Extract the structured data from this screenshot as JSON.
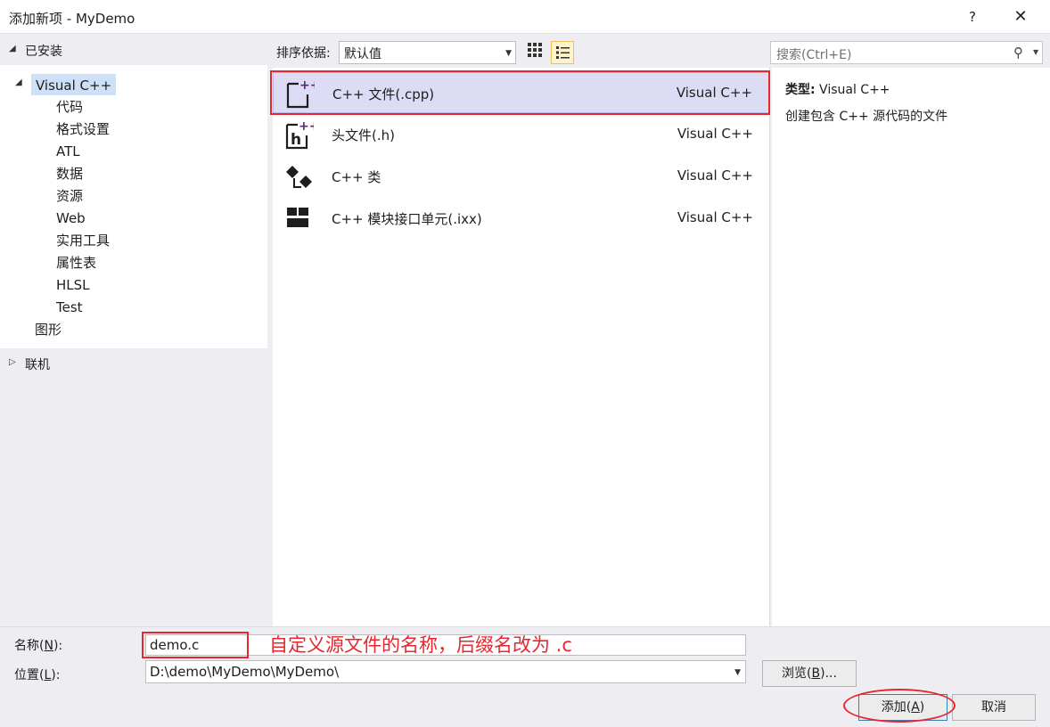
{
  "window": {
    "title": "添加新项 - MyDemo",
    "help": "?",
    "close": "✕"
  },
  "installed": {
    "label": "已安装"
  },
  "tree": {
    "root": "Visual C++",
    "children": [
      "代码",
      "格式设置",
      "ATL",
      "数据",
      "资源",
      "Web",
      "实用工具",
      "属性表",
      "HLSL",
      "Test"
    ],
    "sibling": "图形"
  },
  "online": {
    "label": "联机"
  },
  "toolbar": {
    "sort_label": "排序依据:",
    "sort_value": "默认值"
  },
  "templates": [
    {
      "name": "C++ 文件(.cpp)",
      "lang": "Visual C++",
      "icon": "cpp-file-icon"
    },
    {
      "name": "头文件(.h)",
      "lang": "Visual C++",
      "icon": "header-file-icon"
    },
    {
      "name": "C++ 类",
      "lang": "Visual C++",
      "icon": "class-icon"
    },
    {
      "name": "C++ 模块接口单元(.ixx)",
      "lang": "Visual C++",
      "icon": "module-icon"
    }
  ],
  "search": {
    "placeholder": "搜索(Ctrl+E)"
  },
  "details": {
    "type_label": "类型:",
    "type_value": " Visual C++",
    "description": "创建包含 C++ 源代码的文件"
  },
  "form": {
    "name_label_pre": "名称(",
    "name_label_key": "N",
    "name_label_post": "):",
    "name_value": "demo.c",
    "location_label_pre": "位置(",
    "location_label_key": "L",
    "location_label_post": "):",
    "location_value": "D:\\demo\\MyDemo\\MyDemo\\"
  },
  "annotation": "自定义源文件的名称，后缀名改为 .c",
  "buttons": {
    "browse_pre": "浏览(",
    "browse_key": "B",
    "browse_post": ")...",
    "add_pre": "添加(",
    "add_key": "A",
    "add_post": ")",
    "cancel": "取消"
  },
  "colors": {
    "highlight": "#e8262f",
    "selection": "#dcdcf5",
    "accent_purple": "#68217a"
  }
}
